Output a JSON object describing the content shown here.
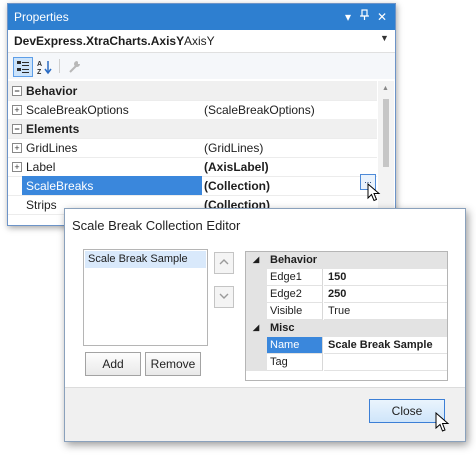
{
  "properties": {
    "title": "Properties",
    "object_name": "DevExpress.XtraCharts.AxisY",
    "object_type": "AxisY",
    "toolbar": {
      "categorized_icon": "categorized-icon",
      "alphabetical_icon": "sort-az-icon",
      "events_icon": "wrench-icon"
    },
    "rows": [
      {
        "label": "Behavior",
        "kind": "category"
      },
      {
        "label": "ScaleBreakOptions",
        "value": "(ScaleBreakOptions)"
      },
      {
        "label": "Elements",
        "kind": "category"
      },
      {
        "label": "GridLines",
        "value": "(GridLines)"
      },
      {
        "label": "Label",
        "value": "(AxisLabel)"
      },
      {
        "label": "ScaleBreaks",
        "value": "(Collection)"
      },
      {
        "label": "Strips",
        "value": "(Collection)"
      }
    ],
    "ellipsis": "..."
  },
  "dialog": {
    "title": "Scale Break Collection Editor",
    "list_items": [
      "Scale Break Sample"
    ],
    "add_label": "Add",
    "remove_label": "Remove",
    "grid": {
      "behavior": "Behavior",
      "edge1_label": "Edge1",
      "edge1_value": "150",
      "edge2_label": "Edge2",
      "edge2_value": "250",
      "visible_label": "Visible",
      "visible_value": "True",
      "misc": "Misc",
      "name_label": "Name",
      "name_value": "Scale Break Sample",
      "tag_label": "Tag",
      "tag_value": ""
    },
    "close_label": "Close"
  },
  "colors": {
    "title_bar": "#2e7fd0",
    "selection": "#3a87dc"
  }
}
